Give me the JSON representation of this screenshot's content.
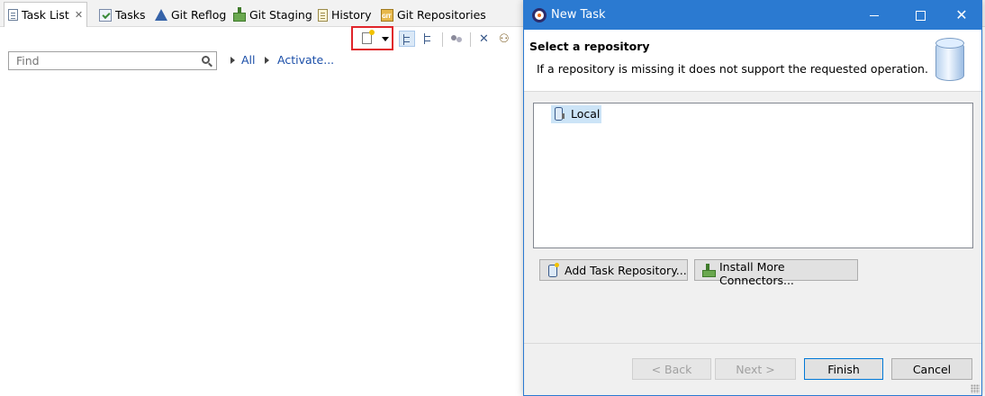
{
  "tabs": [
    {
      "label": "Task List",
      "icon": "task-list-icon",
      "active": true
    },
    {
      "label": "Tasks",
      "icon": "tasks-icon"
    },
    {
      "label": "Git Reflog",
      "icon": "git-reflog-icon"
    },
    {
      "label": "Git Staging",
      "icon": "git-staging-icon"
    },
    {
      "label": "History",
      "icon": "history-icon"
    },
    {
      "label": "Git Repositories",
      "icon": "git-repositories-icon"
    }
  ],
  "find": {
    "placeholder": "Find"
  },
  "links": {
    "all": "All",
    "activate": "Activate..."
  },
  "dialog": {
    "title": "New Task",
    "heading": "Select a repository",
    "message": "If a repository is missing it does not support the requested operation.",
    "repositories": [
      {
        "label": "Local",
        "selected": true
      }
    ],
    "buttons": {
      "add_repository": "Add Task Repository...",
      "install_connectors": "Install More Connectors...",
      "back": "< Back",
      "next": "Next >",
      "finish": "Finish",
      "cancel": "Cancel"
    }
  },
  "colors": {
    "titlebar": "#2b7ad1",
    "highlight_box": "#e0242a",
    "link": "#1a4ea8",
    "selection": "#cce4f7"
  }
}
